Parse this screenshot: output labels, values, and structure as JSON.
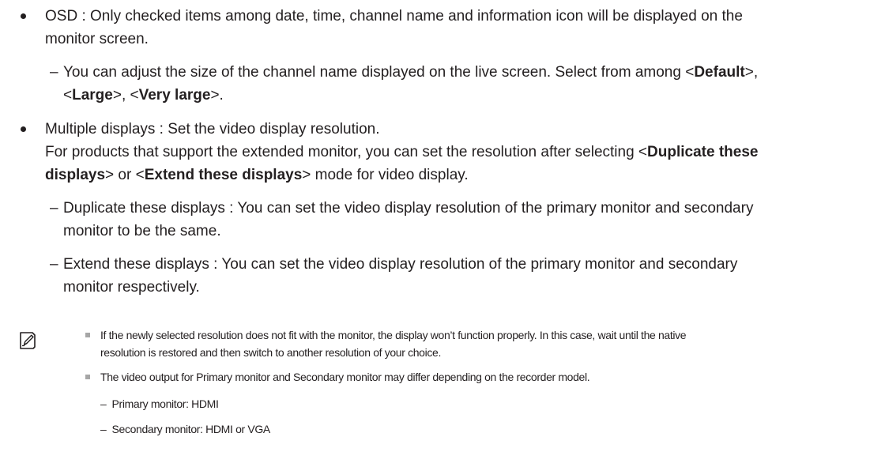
{
  "osd": {
    "label": "OSD : Only checked items among date, time, channel name and information icon will be displayed on the",
    "label_cont": "monitor screen.",
    "sub": {
      "text_a": "You can adjust the size of the channel name displayed on the live screen. Select from among <",
      "opt1": "Default",
      "text_b": ">,",
      "text_c": "<",
      "opt2": "Large",
      "text_d": ">, <",
      "opt3": "Very large",
      "text_e": ">."
    }
  },
  "multi": {
    "line1": "Multiple displays : Set the video display resolution.",
    "line2a": "For products that support the extended monitor, you can set the resolution after selecting <",
    "mode1a": "Duplicate these",
    "mode1b": "displays",
    "line3a": "> or <",
    "mode2": "Extend these displays",
    "line3b": "> mode for video display.",
    "dup": {
      "line1": "Duplicate these displays : You can set the video display resolution of the primary monitor and secondary",
      "line2": "monitor to be the same."
    },
    "ext": {
      "line1": "Extend these displays : You can set the video display resolution of the primary monitor and secondary",
      "line2": "monitor respectively."
    }
  },
  "dash_glyph": "–",
  "note": {
    "icon": "note-pencil-icon",
    "item1_line1": "If the newly selected resolution does not fit with the monitor, the display won’t function properly. In this case, wait until the native",
    "item1_line2": "resolution is restored and then switch to another resolution of your choice.",
    "item2": "The video output for Primary monitor and Secondary monitor may differ depending on the recorder model.",
    "sub1": "Primary monitor: HDMI",
    "sub2": "Secondary monitor: HDMI or VGA"
  }
}
